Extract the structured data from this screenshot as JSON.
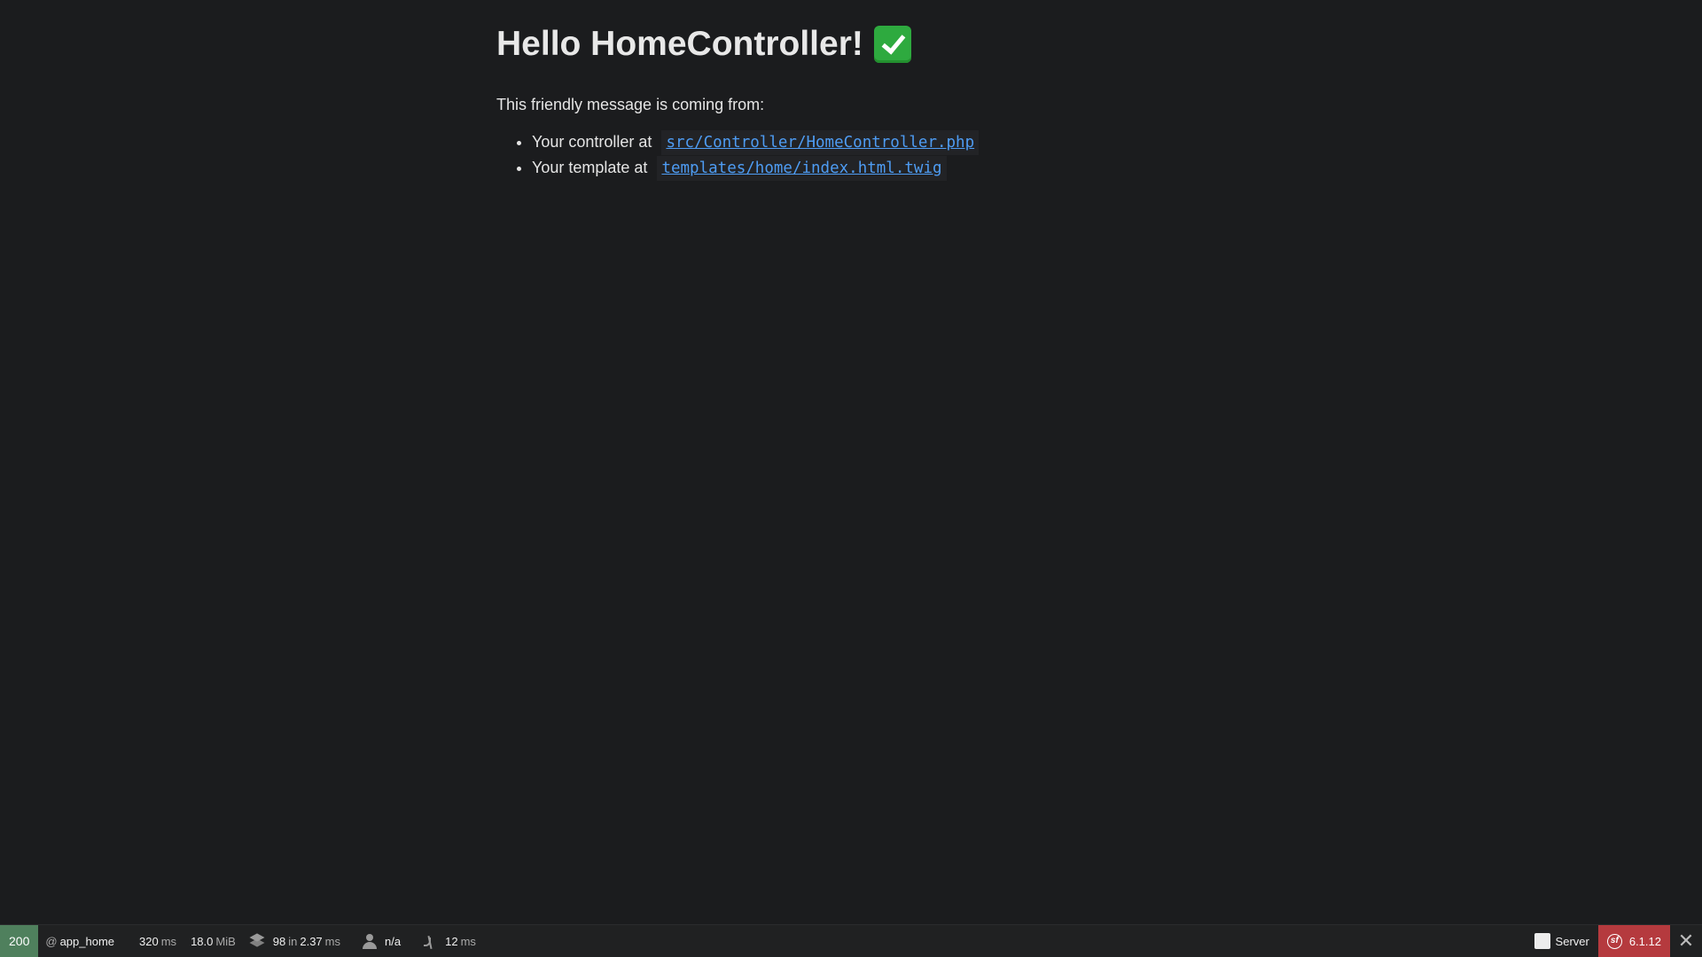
{
  "main": {
    "heading": "Hello HomeController!",
    "heading_icon": "check-mark-icon",
    "intro": "This friendly message is coming from:",
    "items": [
      {
        "label": "Your controller at",
        "code": "src/Controller/HomeController.php"
      },
      {
        "label": "Your template at",
        "code": "templates/home/index.html.twig"
      }
    ]
  },
  "toolbar": {
    "status_code": "200",
    "route_prefix": "@",
    "route": "app_home",
    "time_value": "320",
    "time_unit": "ms",
    "memory_value": "18.0",
    "memory_unit": "MiB",
    "db_queries": "98",
    "db_in": "in",
    "db_time": "2.37",
    "db_unit": "ms",
    "user": "n/a",
    "twig_time": "12",
    "twig_unit": "ms",
    "server_label": "Server",
    "version": "6.1.12",
    "close_icon": "close-icon"
  },
  "colors": {
    "background": "#1b1c1e",
    "link": "#4e9cf3",
    "status_ok": "#4f805d",
    "symfony_red": "#b53a3e"
  }
}
